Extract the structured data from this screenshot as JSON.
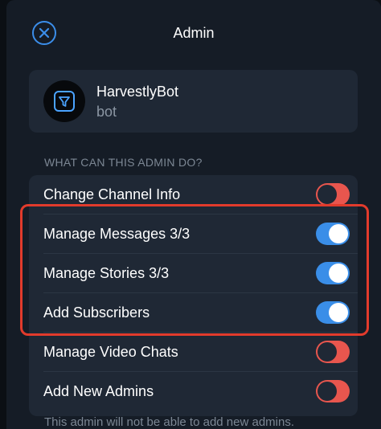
{
  "header": {
    "title": "Admin",
    "close_icon": "close-circle-icon"
  },
  "bot": {
    "name": "HarvestlyBot",
    "subtitle": "bot",
    "avatar_icon": "funnel-icon"
  },
  "permissions": {
    "section_label": "WHAT CAN THIS ADMIN DO?",
    "items": [
      {
        "label": "Change Channel Info",
        "enabled": false
      },
      {
        "label": "Manage Messages 3/3",
        "enabled": true
      },
      {
        "label": "Manage Stories 3/3",
        "enabled": true
      },
      {
        "label": "Add Subscribers",
        "enabled": true
      },
      {
        "label": "Manage Video Chats",
        "enabled": false
      },
      {
        "label": "Add New Admins",
        "enabled": false
      }
    ]
  },
  "footer_note": "This admin will not be able to add new admins.",
  "colors": {
    "accent": "#3a8ee8",
    "toggle_off": "#e8564e",
    "highlight": "#e23b2c"
  }
}
